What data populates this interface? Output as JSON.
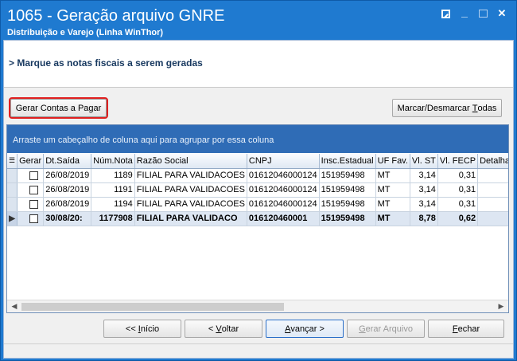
{
  "window": {
    "title": "1065 - Geração arquivo GNRE",
    "subtitle": "Distribuição e Varejo (Linha WinThor)",
    "controls": {
      "restore": "",
      "minimize": "_",
      "maximize": "",
      "close": "✕"
    }
  },
  "header": {
    "instruction": "> Marque as notas fiscais a serem geradas"
  },
  "toolbar": {
    "gerar_contas_label": "Gerar Contas a Pagar",
    "marcar_desmarcar_prefix": "Marcar/Desmarcar ",
    "marcar_desmarcar_accel": "T",
    "marcar_desmarcar_suffix": "odas"
  },
  "grid": {
    "group_hint": "Arraste um cabeçalho de coluna aqui para agrupar por essa coluna",
    "columns": [
      "Gerar",
      "Dt.Saída",
      "Núm.Nota",
      "Razão Social",
      "CNPJ",
      "Insc.Estadual",
      "UF Fav.",
      "Vl. ST",
      "Vl. FECP",
      "Detalhame"
    ],
    "rows": [
      {
        "dt": "26/08/2019",
        "num": "1189",
        "razao": "FILIAL PARA VALIDACOES",
        "cnpj": "01612046000124",
        "ie": "151959498",
        "uf": "MT",
        "vlst": "3,14",
        "fecp": "0,31",
        "det": ""
      },
      {
        "dt": "26/08/2019",
        "num": "1191",
        "razao": "FILIAL PARA VALIDACOES",
        "cnpj": "01612046000124",
        "ie": "151959498",
        "uf": "MT",
        "vlst": "3,14",
        "fecp": "0,31",
        "det": ""
      },
      {
        "dt": "26/08/2019",
        "num": "1194",
        "razao": "FILIAL PARA VALIDACOES",
        "cnpj": "01612046000124",
        "ie": "151959498",
        "uf": "MT",
        "vlst": "3,14",
        "fecp": "0,31",
        "det": ""
      },
      {
        "dt": "30/08/20:",
        "num": "1177908",
        "razao": "FILIAL PARA VALIDACO",
        "cnpj": "016120460001",
        "ie": "151959498",
        "uf": "MT",
        "vlst": "8,78",
        "fecp": "0,62",
        "det": ""
      }
    ]
  },
  "footer": {
    "inicio_prefix": "<< ",
    "inicio_accel": "I",
    "inicio_suffix": "nício",
    "voltar_prefix": "< ",
    "voltar_accel": "V",
    "voltar_suffix": "oltar",
    "avancar_accel": "A",
    "avancar_suffix": "vançar >",
    "gerar_arquivo_accel": "G",
    "gerar_arquivo_suffix": "erar Arquivo",
    "fechar_accel": "F",
    "fechar_suffix": "echar"
  }
}
